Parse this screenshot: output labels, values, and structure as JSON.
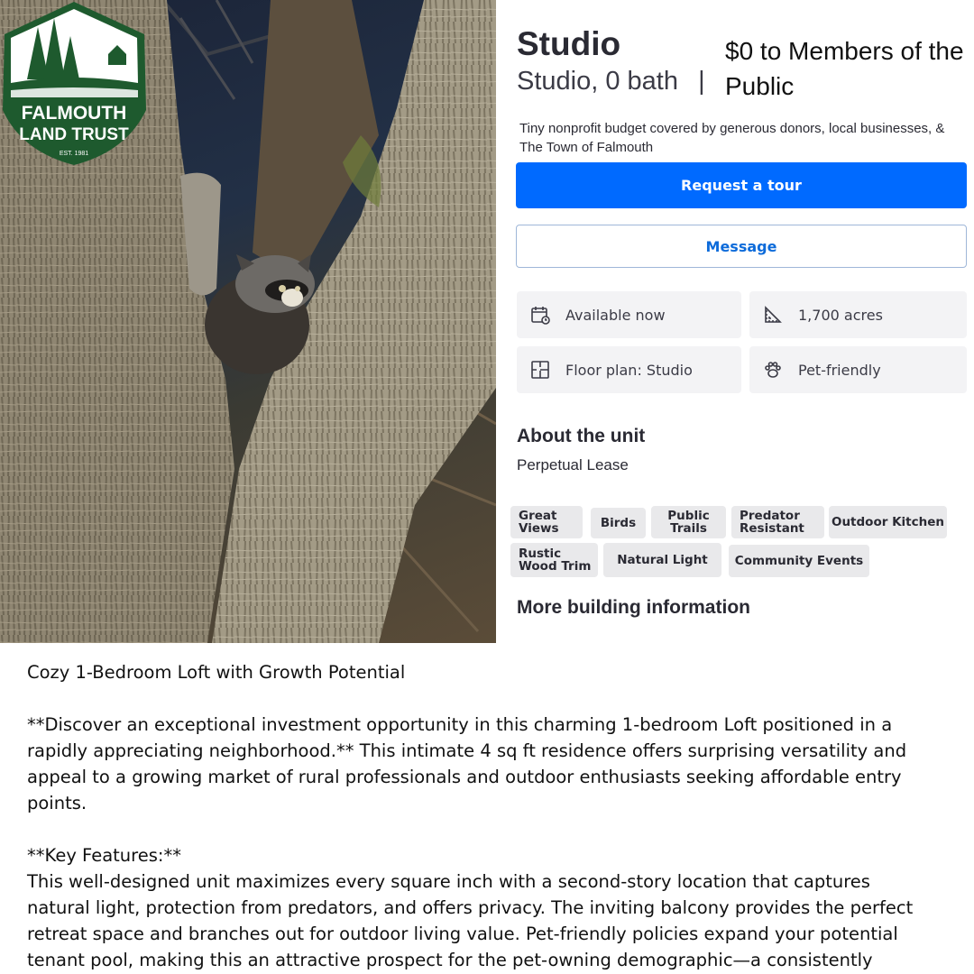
{
  "photo": {
    "alt_subject": "raccoon-in-tree"
  },
  "logo": {
    "line1": "FALMOUTH",
    "line2": "LAND TRUST",
    "established": "EST. 1981",
    "color": "#1e5a2e"
  },
  "listing": {
    "title": "Studio",
    "subtitle_beds": "Studio,",
    "subtitle_baths": "0 bath",
    "subtitle_sep": "|",
    "price": "$0 to Members of the Public",
    "funding_note": "Tiny nonprofit budget covered by generous donors, local businesses, & The Town of Falmouth"
  },
  "actions": {
    "request_tour": "Request a tour",
    "message": "Message",
    "primary_color": "#006aff"
  },
  "facts": [
    {
      "icon": "calendar-icon",
      "label": "Available now"
    },
    {
      "icon": "ruler-icon",
      "label": "1,700 acres"
    },
    {
      "icon": "floor-plan-icon",
      "label": "Floor plan: Studio"
    },
    {
      "icon": "paw-icon",
      "label": "Pet-friendly"
    }
  ],
  "about": {
    "heading": "About the unit",
    "text": "Perpetual Lease"
  },
  "tags": [
    "Great\nViews",
    "Birds",
    "Public\nTrails",
    "Predator\nResistant",
    "Outdoor Kitchen",
    "Rustic\nWood Trim",
    "Natural Light",
    "Community Events"
  ],
  "more_info_heading": "More building information",
  "description": {
    "headline": "Cozy 1-Bedroom Loft with Growth Potential",
    "para1_lines": [
      "**Discover an exceptional investment opportunity in this charming 1-bedroom Loft positioned in a",
      "rapidly appreciating neighborhood.** This intimate 4 sq ft residence offers surprising versatility and",
      "appeal to a growing market of rural professionals and outdoor enthusiasts seeking affordable entry",
      "points."
    ],
    "key_features_heading": "**Key Features:**",
    "para2_lines": [
      "This well-designed unit maximizes every square inch with a second-story location that captures",
      "natural light, protection from predators, and offers privacy. The inviting balcony provides the perfect",
      "retreat space and branches out for outdoor living value. Pet-friendly policies expand your potential",
      "tenant pool, making this an attractive prospect for the pet-owning demographic—a consistently"
    ]
  }
}
